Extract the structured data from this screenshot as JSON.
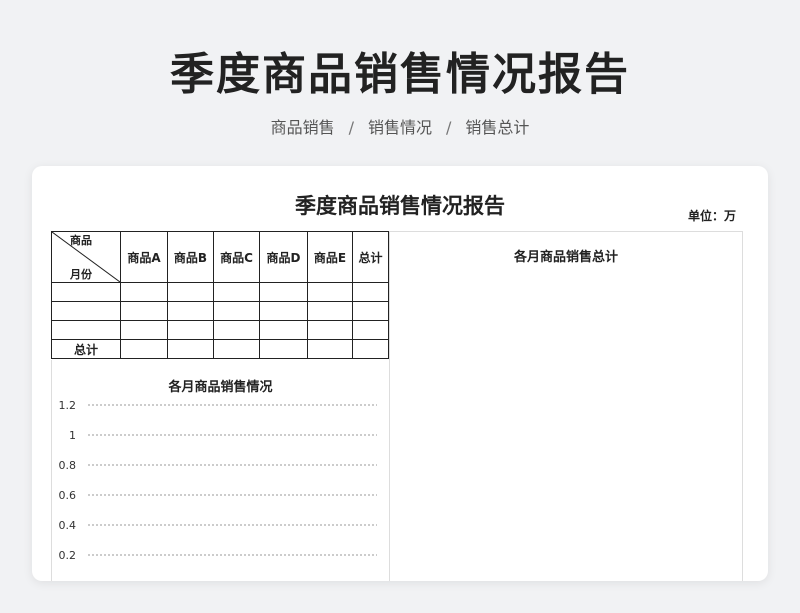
{
  "header": {
    "title": "季度商品销售情况报告",
    "breadcrumb": [
      "商品销售",
      "销售情况",
      "销售总计"
    ]
  },
  "sheet": {
    "title": "季度商品销售情况报告",
    "unit": "单位：万",
    "table": {
      "corner_top": "商品",
      "corner_bottom": "月份",
      "columns": [
        "商品A",
        "商品B",
        "商品C",
        "商品D",
        "商品E",
        "总计"
      ],
      "rows": [
        {
          "label": "",
          "cells": [
            "",
            "",
            "",
            "",
            "",
            ""
          ]
        },
        {
          "label": "",
          "cells": [
            "",
            "",
            "",
            "",
            "",
            ""
          ]
        },
        {
          "label": "",
          "cells": [
            "",
            "",
            "",
            "",
            "",
            ""
          ]
        },
        {
          "label": "总计",
          "cells": [
            "",
            "",
            "",
            "",
            "",
            ""
          ]
        }
      ]
    },
    "monthly_chart": {
      "title": "各月商品销售情况",
      "y_ticks": [
        "1.2",
        "1",
        "0.8",
        "0.6",
        "0.4",
        "0.2"
      ]
    },
    "total_chart": {
      "title": "各月商品销售总计"
    }
  }
}
